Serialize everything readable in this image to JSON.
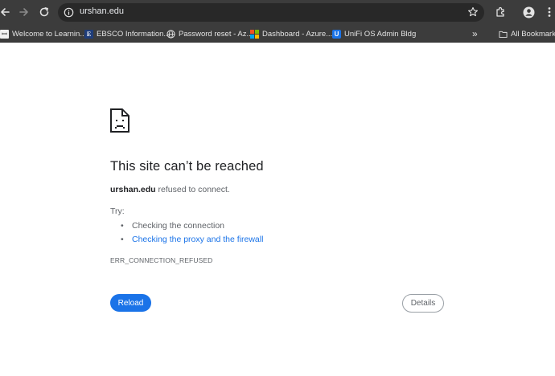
{
  "browser": {
    "url": "urshan.edu",
    "icons": {
      "back": "arrow-left-icon",
      "forward": "arrow-right-icon",
      "reload": "reload-icon",
      "site_info": "info-icon",
      "bookmark_star": "star-icon",
      "extensions": "puzzle-icon",
      "profile": "person-icon",
      "menu": "kebab-menu-icon"
    }
  },
  "bookmarks": {
    "items": [
      {
        "label": "Welcome to Learnin...",
        "icon": "learning-favicon"
      },
      {
        "label": "EBSCO Information...",
        "icon": "ebsco-favicon"
      },
      {
        "label": "Password reset - Az...",
        "icon": "globe-icon"
      },
      {
        "label": "Dashboard - Azure...",
        "icon": "microsoft-favicon"
      },
      {
        "label": "UniFi OS Admin Bldg",
        "icon": "unifi-favicon"
      }
    ],
    "overflow": "»",
    "all_bookmarks": "All Bookmarks"
  },
  "error_page": {
    "icon": "sad-page-icon",
    "title": "This site can’t be reached",
    "host": "urshan.edu",
    "message": " refused to connect.",
    "try_label": "Try:",
    "suggestions": [
      "Checking the connection",
      "Checking the proxy and the firewall"
    ],
    "error_code": "ERR_CONNECTION_REFUSED",
    "reload_button": "Reload",
    "details_button": "Details"
  },
  "colors": {
    "chrome_toolbar": "#3c3c3c",
    "omnibox": "#282828",
    "primary_button": "#1a73e8",
    "link": "#1a73e8",
    "text_primary": "#202124",
    "text_secondary": "#5f6368"
  }
}
